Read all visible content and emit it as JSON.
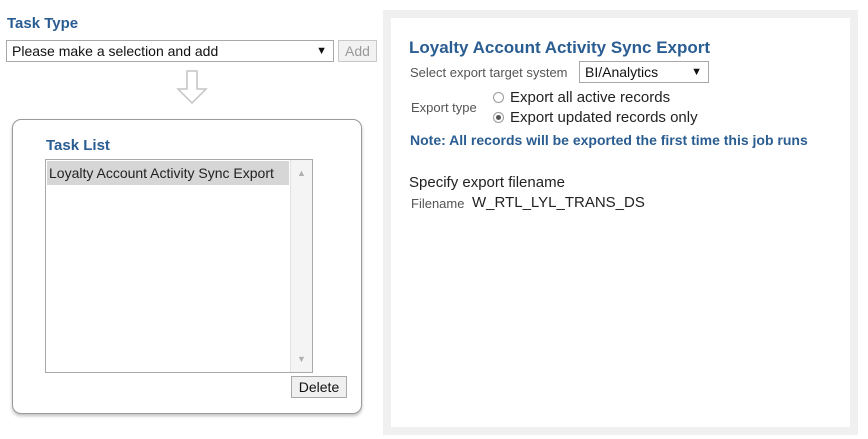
{
  "task_type": {
    "label": "Task Type",
    "select_value": "Please make a selection and add",
    "add_label": "Add"
  },
  "task_list": {
    "label": "Task List",
    "items": [
      "Loyalty Account Activity Sync Export"
    ],
    "delete_label": "Delete"
  },
  "export_panel": {
    "title": "Loyalty Account Activity Sync Export",
    "target_label": "Select export target system",
    "target_value": "BI/Analytics",
    "export_type_label": "Export type",
    "options": [
      "Export all active records",
      "Export updated records only"
    ],
    "selected_option": 1,
    "note": "Note: All records will be exported the first time this job runs",
    "filename_heading": "Specify export filename",
    "filename_label": "Filename",
    "filename_value": "W_RTL_LYL_TRANS_DS"
  },
  "colors": {
    "heading": "#2a5d92",
    "panel_bg": "#f0f0f0",
    "selected_item_bg": "#d6d6d6"
  },
  "icons": {
    "select_arrow": "triangle-down-icon",
    "flow_arrow": "arrow-down-icon",
    "scroll_up": "scroll-up-icon",
    "scroll_down": "scroll-down-icon"
  }
}
